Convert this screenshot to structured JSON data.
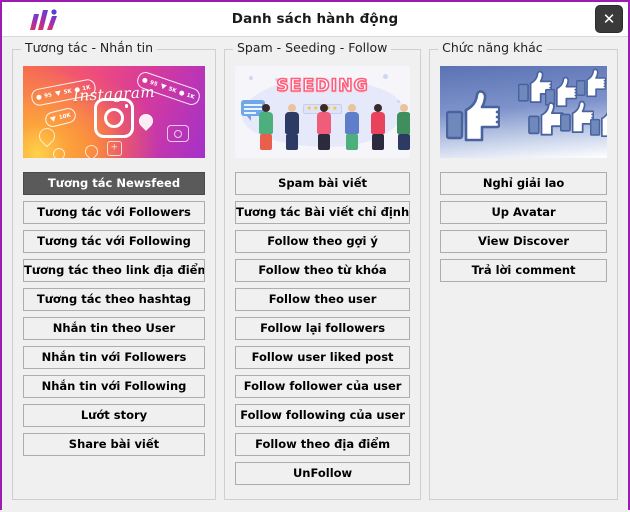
{
  "window": {
    "title": "Danh sách hành động",
    "close_label": "✕",
    "border_color": "#9c1cb4",
    "logo_name": "app-logo"
  },
  "columns": [
    {
      "title": "Tương tác - Nhắn tin",
      "banner": {
        "name": "instagram-banner",
        "wordmark": "Instagram",
        "badges": [
          "95",
          "5K",
          "1K",
          "10K"
        ]
      },
      "buttons": [
        {
          "label": "Tương tác Newsfeed",
          "selected": true
        },
        {
          "label": "Tương tác với Followers",
          "selected": false
        },
        {
          "label": "Tương tác với Following",
          "selected": false
        },
        {
          "label": "Tương tác theo link địa điểm",
          "selected": false
        },
        {
          "label": "Tương tác theo hashtag",
          "selected": false
        },
        {
          "label": "Nhắn tin theo User",
          "selected": false
        },
        {
          "label": "Nhắn tin với Followers",
          "selected": false
        },
        {
          "label": "Nhắn tin với Following",
          "selected": false
        },
        {
          "label": "Lướt story",
          "selected": false
        },
        {
          "label": "Share bài viết",
          "selected": false
        }
      ]
    },
    {
      "title": "Spam - Seeding - Follow",
      "banner": {
        "name": "seeding-banner",
        "wordmark": "SEEDING",
        "stars": "★★★★★"
      },
      "buttons": [
        {
          "label": "Spam bài viết",
          "selected": false
        },
        {
          "label": "Tương tác Bài viết chỉ định",
          "selected": false
        },
        {
          "label": "Follow theo gợi ý",
          "selected": false
        },
        {
          "label": "Follow theo từ khóa",
          "selected": false
        },
        {
          "label": "Follow theo user",
          "selected": false
        },
        {
          "label": "Follow lại followers",
          "selected": false
        },
        {
          "label": "Follow user liked post",
          "selected": false
        },
        {
          "label": "Follow follower của user",
          "selected": false
        },
        {
          "label": "Follow following của user",
          "selected": false
        },
        {
          "label": "Follow theo địa điểm",
          "selected": false
        },
        {
          "label": "UnFollow",
          "selected": false
        }
      ]
    },
    {
      "title": "Chức năng khác",
      "banner": {
        "name": "facebook-likes-banner"
      },
      "buttons": [
        {
          "label": "Nghỉ giải lao",
          "selected": false
        },
        {
          "label": "Up Avatar",
          "selected": false
        },
        {
          "label": "View Discover",
          "selected": false
        },
        {
          "label": "Trả lời comment",
          "selected": false
        }
      ]
    }
  ]
}
